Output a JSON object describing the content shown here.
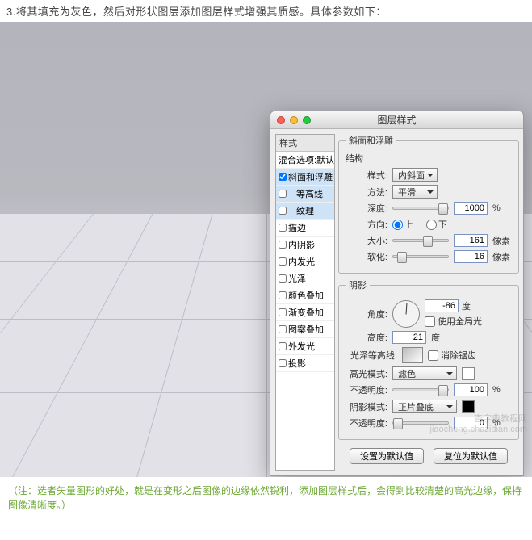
{
  "page": {
    "step_title": "3.将其填充为灰色，然后对形状图层添加图层样式增强其质感。具体参数如下：",
    "footer_note": "（注：选者矢量图形的好处，就是在变形之后图像的边缘依然锐利，添加图层样式后，会得到比较清楚的高光边缘，保持图像清晰度。）",
    "watermark_line1": "查字典教程网",
    "watermark_line2": "jiaocheng.chazidian.com"
  },
  "dialog": {
    "title": "图层样式",
    "list_header": "样式",
    "styles": [
      {
        "label": "混合选项:默认",
        "checked": null,
        "selected": false,
        "sub": false
      },
      {
        "label": "斜面和浮雕",
        "checked": true,
        "selected": true,
        "sub": false
      },
      {
        "label": "等高线",
        "checked": false,
        "selected": true,
        "sub": true
      },
      {
        "label": "纹理",
        "checked": false,
        "selected": true,
        "sub": true
      },
      {
        "label": "描边",
        "checked": false,
        "selected": false,
        "sub": false
      },
      {
        "label": "内阴影",
        "checked": false,
        "selected": false,
        "sub": false
      },
      {
        "label": "内发光",
        "checked": false,
        "selected": false,
        "sub": false
      },
      {
        "label": "光泽",
        "checked": false,
        "selected": false,
        "sub": false
      },
      {
        "label": "颜色叠加",
        "checked": false,
        "selected": false,
        "sub": false
      },
      {
        "label": "渐变叠加",
        "checked": false,
        "selected": false,
        "sub": false
      },
      {
        "label": "图案叠加",
        "checked": false,
        "selected": false,
        "sub": false
      },
      {
        "label": "外发光",
        "checked": false,
        "selected": false,
        "sub": false
      },
      {
        "label": "投影",
        "checked": false,
        "selected": false,
        "sub": false
      }
    ],
    "group_bevel": {
      "legend": "斜面和浮雕",
      "sub_legend": "结构",
      "style_label": "样式:",
      "style_value": "内斜面",
      "method_label": "方法:",
      "method_value": "平滑",
      "depth_label": "深度:",
      "depth_value": "1000",
      "depth_unit": "%",
      "direction_label": "方向:",
      "dir_up": "上",
      "dir_down": "下",
      "size_label": "大小:",
      "size_value": "161",
      "size_unit": "像素",
      "soften_label": "软化:",
      "soften_value": "16",
      "soften_unit": "像素"
    },
    "group_shade": {
      "legend": "阴影",
      "angle_label": "角度:",
      "angle_value": "-86",
      "angle_unit": "度",
      "global_light": "使用全局光",
      "altitude_label": "高度:",
      "altitude_value": "21",
      "altitude_unit": "度",
      "gloss_label": "光泽等高线:",
      "anti_alias": "消除锯齿",
      "highlight_mode_label": "高光模式:",
      "highlight_mode_value": "滤色",
      "opacity_label": "不透明度:",
      "highlight_opacity": "100",
      "shadow_mode_label": "阴影模式:",
      "shadow_mode_value": "正片叠底",
      "shadow_opacity": "0",
      "pct": "%"
    },
    "buttons": {
      "set_default": "设置为默认值",
      "reset_default": "复位为默认值"
    }
  }
}
